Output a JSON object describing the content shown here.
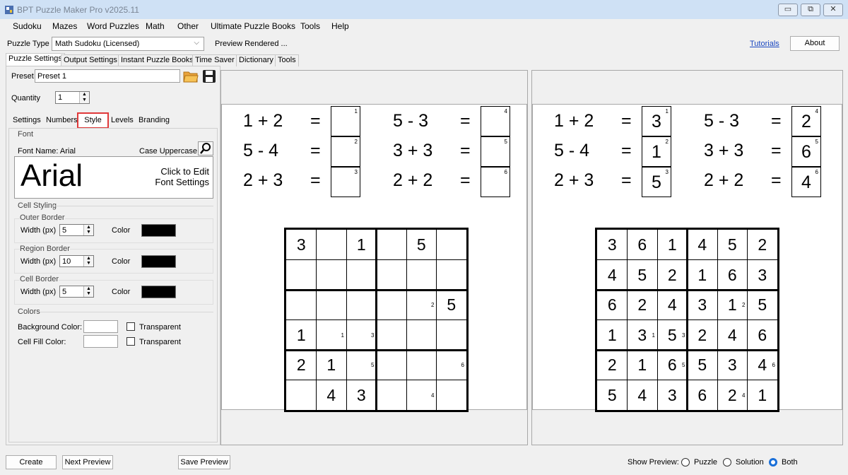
{
  "window": {
    "title": "BPT Puzzle Maker Pro v2025.11",
    "minimize": "▭",
    "maximize": "⧉",
    "close": "✕"
  },
  "menu": [
    "Sudoku",
    "Mazes",
    "Word Puzzles",
    "Math",
    "Other",
    "Ultimate Puzzle Books",
    "Tools",
    "Help"
  ],
  "toolbar": {
    "puzzle_type_label": "Puzzle Type",
    "puzzle_type_value": "Math Sudoku (Licensed)",
    "status": "Preview Rendered ...",
    "tutorials": "Tutorials",
    "about": "About"
  },
  "main_tabs": [
    "Puzzle Settings",
    "Output Settings",
    "Instant Puzzle Books",
    "Time Saver",
    "Dictionary",
    "Tools"
  ],
  "settings": {
    "preset_label": "Preset",
    "preset_value": "Preset 1",
    "quantity_label": "Quantity",
    "quantity_value": "1",
    "sub_tabs": [
      "Settings",
      "Numbers",
      "Style",
      "Levels",
      "Branding"
    ],
    "font_group": "Font",
    "font_name": "Font Name: Arial",
    "case": "Case Uppercase",
    "font_sample": "Arial",
    "font_edit": [
      "Click to Edit",
      "Font Settings"
    ],
    "cell_styling": "Cell Styling",
    "borders": [
      {
        "title": "Outer Border",
        "width_label": "Width (px)",
        "width": "5",
        "color_label": "Color",
        "color": "#000000"
      },
      {
        "title": "Region Border",
        "width_label": "Width (px)",
        "width": "10",
        "color_label": "Color",
        "color": "#000000"
      },
      {
        "title": "Cell Border",
        "width_label": "Width (px)",
        "width": "5",
        "color_label": "Color",
        "color": "#000000"
      }
    ],
    "colors_group": "Colors",
    "bg_label": "Background Color:",
    "fill_label": "Cell Fill Color:",
    "transparent": "Transparent"
  },
  "puzzle": {
    "equations": [
      {
        "expr": "1 + 2",
        "eq": "=",
        "num": "1",
        "ans": "3"
      },
      {
        "expr": "5 - 4",
        "eq": "=",
        "num": "2",
        "ans": "1"
      },
      {
        "expr": "2 + 3",
        "eq": "=",
        "num": "3",
        "ans": "5"
      },
      {
        "expr": "5 - 3",
        "eq": "=",
        "num": "4",
        "ans": "2"
      },
      {
        "expr": "3 + 3",
        "eq": "=",
        "num": "5",
        "ans": "6"
      },
      {
        "expr": "2 + 2",
        "eq": "=",
        "num": "6",
        "ans": "4"
      }
    ],
    "grid_puzzle": [
      [
        "3",
        "",
        "1",
        "",
        "5",
        ""
      ],
      [
        "",
        "",
        "",
        "",
        "",
        ""
      ],
      [
        "",
        "",
        "",
        "",
        "",
        "5"
      ],
      [
        "1",
        "",
        "",
        "",
        "",
        ""
      ],
      [
        "2",
        "1",
        "",
        "",
        "",
        ""
      ],
      [
        "",
        "4",
        "3",
        "",
        "",
        ""
      ]
    ],
    "grid_solution": [
      [
        "3",
        "6",
        "1",
        "4",
        "5",
        "2"
      ],
      [
        "4",
        "5",
        "2",
        "1",
        "6",
        "3"
      ],
      [
        "6",
        "2",
        "4",
        "3",
        "1",
        "5"
      ],
      [
        "1",
        "3",
        "5",
        "2",
        "4",
        "6"
      ],
      [
        "2",
        "1",
        "6",
        "5",
        "3",
        "4"
      ],
      [
        "5",
        "4",
        "3",
        "6",
        "2",
        "1"
      ]
    ],
    "corner_marks": [
      {
        "r": 2,
        "c": 4,
        "n": "2"
      },
      {
        "r": 3,
        "c": 1,
        "n": "1"
      },
      {
        "r": 3,
        "c": 2,
        "n": "3"
      },
      {
        "r": 4,
        "c": 2,
        "n": "5"
      },
      {
        "r": 4,
        "c": 5,
        "n": "6"
      },
      {
        "r": 5,
        "c": 4,
        "n": "4"
      }
    ]
  },
  "bottom": {
    "create": "Create",
    "next": "Next Preview",
    "save": "Save Preview",
    "show_label": "Show Preview:",
    "options": [
      "Puzzle",
      "Solution",
      "Both"
    ]
  }
}
